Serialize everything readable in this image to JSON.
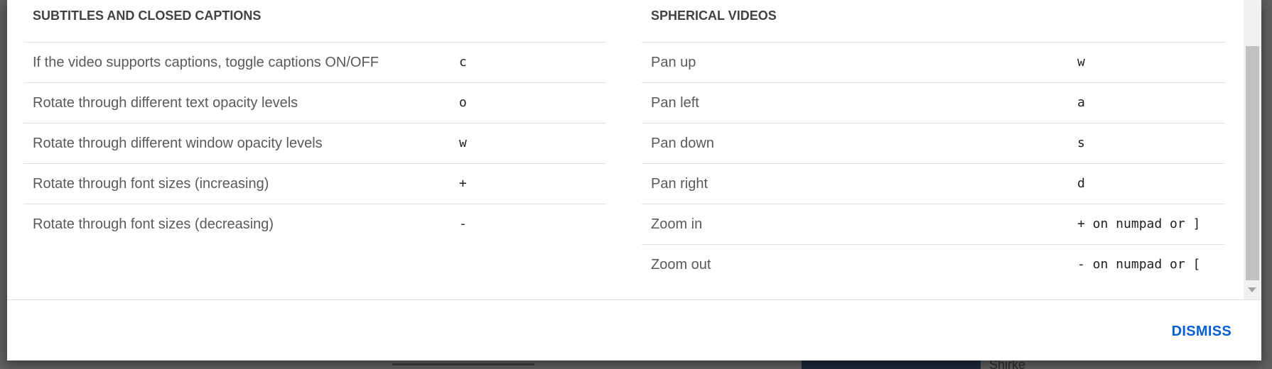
{
  "background": {
    "peek_text": "Shirke"
  },
  "dialog": {
    "sections": {
      "captions": {
        "title": "SUBTITLES AND CLOSED CAPTIONS",
        "rows": [
          {
            "desc": "If the video supports captions, toggle captions ON/OFF",
            "key": "c"
          },
          {
            "desc": "Rotate through different text opacity levels",
            "key": "o"
          },
          {
            "desc": "Rotate through different window opacity levels",
            "key": "w"
          },
          {
            "desc": "Rotate through font sizes (increasing)",
            "key": "+"
          },
          {
            "desc": "Rotate through font sizes (decreasing)",
            "key": "-"
          }
        ]
      },
      "spherical": {
        "title": "SPHERICAL VIDEOS",
        "rows": [
          {
            "desc": "Pan up",
            "key": "w"
          },
          {
            "desc": "Pan left",
            "key": "a"
          },
          {
            "desc": "Pan down",
            "key": "s"
          },
          {
            "desc": "Pan right",
            "key": "d"
          },
          {
            "desc": "Zoom in",
            "key": "+ on numpad or ]"
          },
          {
            "desc": "Zoom out",
            "key": "- on numpad or ["
          }
        ]
      }
    },
    "footer": {
      "dismiss_label": "DISMISS"
    }
  },
  "colors": {
    "accent": "#065fd4",
    "overlay": "#5f5f5f"
  }
}
